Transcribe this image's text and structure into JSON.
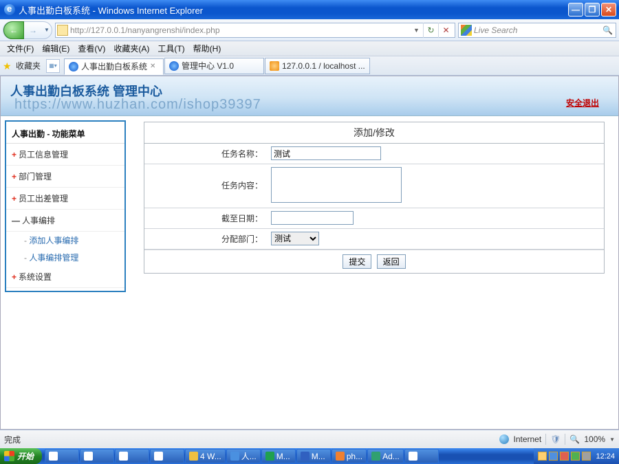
{
  "window": {
    "title": "人事出勤白板系统 - Windows Internet Explorer"
  },
  "nav": {
    "url": "http://127.0.0.1/nanyangrenshi/index.php",
    "search_placeholder": "Live Search"
  },
  "menubar": {
    "file": "文件(F)",
    "edit": "编辑(E)",
    "view": "查看(V)",
    "favorites": "收藏夹(A)",
    "tools": "工具(T)",
    "help": "帮助(H)"
  },
  "tabbar": {
    "fav_label": "收藏夹",
    "tabs": [
      {
        "label": "人事出勤白板系统",
        "active": true,
        "icon": "ie"
      },
      {
        "label": "管理中心  V1.0",
        "active": false,
        "icon": "ie"
      },
      {
        "label": "127.0.0.1 / localhost ...",
        "active": false,
        "icon": "wamp"
      }
    ]
  },
  "app": {
    "header_title": "人事出勤白板系统 管理中心",
    "watermark": "https://www.huzhan.com/ishop39397",
    "logout": "安全退出"
  },
  "sidebar": {
    "title": "人事出勤 - 功能菜单",
    "items": [
      {
        "label": "员工信息管理",
        "mark": "plus"
      },
      {
        "label": "部门管理",
        "mark": "plus"
      },
      {
        "label": "员工出差管理",
        "mark": "plus"
      },
      {
        "label": "人事编排",
        "mark": "minus"
      },
      {
        "label": "系统设置",
        "mark": "plus"
      }
    ],
    "subitems": [
      "添加人事编排",
      "人事编排管理"
    ]
  },
  "form": {
    "title": "添加/修改",
    "task_name_label": "任务名称：",
    "task_name_value": "测试",
    "task_content_label": "任务内容：",
    "task_content_value": "",
    "deadline_label": "截至日期：",
    "deadline_value": "",
    "dept_label": "分配部门：",
    "dept_value": "测试",
    "submit": "提交",
    "back": "返回"
  },
  "statusbar": {
    "left": "完成",
    "zone": "Internet",
    "zoom": "100%"
  },
  "taskbar": {
    "start": "开始",
    "buttons": [
      "",
      "",
      "",
      "",
      "4 W...",
      "人...",
      "M...",
      "M...",
      "ph...",
      "Ad...",
      ""
    ],
    "time": "12:24"
  }
}
